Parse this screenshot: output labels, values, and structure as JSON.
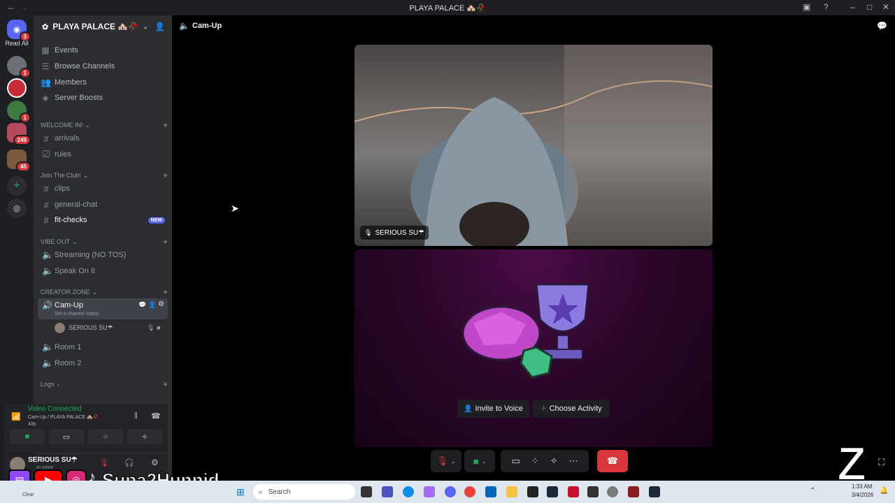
{
  "window": {
    "title": "PLAYA PALACE 🏘️🥀"
  },
  "rail": {
    "read_all": "Read All",
    "dm_badge": "3",
    "server_badges": [
      "1",
      "",
      "1",
      "249",
      "45"
    ]
  },
  "server": {
    "name": "PLAYA PALACE 🏘️🥀",
    "nav": [
      {
        "label": "Events",
        "icon": "calendar-icon"
      },
      {
        "label": "Browse Channels",
        "icon": "list-icon"
      },
      {
        "label": "Members",
        "icon": "members-icon"
      },
      {
        "label": "Server Boosts",
        "icon": "boost-icon"
      }
    ],
    "categories": {
      "welcome": "WELCOME IN!",
      "join": "Join The Club!",
      "vibe": "VIBE OUT",
      "creator": "CREATOR ZONE",
      "logs": "Logs"
    },
    "channels": {
      "arrivals": "arrivals",
      "rules": "rules",
      "clips": "clips",
      "general": "general-chat",
      "fit": "fit-checks",
      "new_badge": "NEW",
      "streaming": "Streaming (NO TOS)",
      "speak": "Speak On It",
      "camup": "Cam-Up",
      "camup_status": "Set a channel status",
      "camup_user": "SERIOUS SU☂",
      "room1": "Room 1",
      "room2": "Room 2"
    }
  },
  "voice": {
    "status": "Video Connected",
    "location": "Cam-Up / PLAYA PALACE 🏘️🥀",
    "elapsed": "43s"
  },
  "user": {
    "name": "SERIOUS SU☂",
    "status": "In voice"
  },
  "main": {
    "channel_title": "Cam-Up",
    "video_user_label": "SERIOUS SU☂",
    "invite_label": "Invite to Voice",
    "activity_label": "Choose Activity"
  },
  "overlay": {
    "streamer": "Supa2Hunnid"
  },
  "taskbar": {
    "search_placeholder": "Search",
    "clear": "Clear",
    "time": "1:33 AM",
    "date": "3/4/2026"
  },
  "colors": {
    "accent": "#5865f2",
    "green": "#23a55a",
    "red": "#da373c"
  }
}
